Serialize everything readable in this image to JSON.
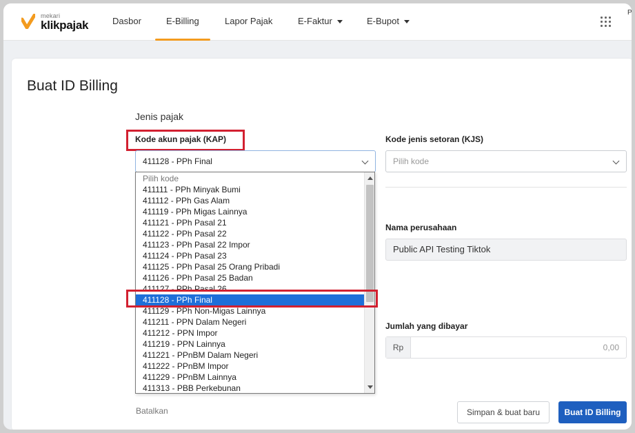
{
  "nav": {
    "logo_small": "mekari",
    "logo_big": "klikpajak",
    "items": [
      {
        "label": "Dasbor"
      },
      {
        "label": "E-Billing"
      },
      {
        "label": "Lapor Pajak"
      },
      {
        "label": "E-Faktur"
      },
      {
        "label": "E-Bupot"
      }
    ],
    "corner_letter": "P",
    "accent_color": "#f39b1f"
  },
  "page": {
    "title": "Buat ID Billing",
    "section": "Jenis pajak"
  },
  "form": {
    "kap_label": "Kode akun pajak (KAP)",
    "kap_value": "411128 - PPh Final",
    "kjs_label": "Kode jenis setoran (KJS)",
    "kjs_placeholder": "Pilih kode",
    "company_label": "Nama perusahaan",
    "company_value": "Public API Testing Tiktok",
    "amount_label": "Jumlah yang dibayar",
    "amount_prefix": "Rp",
    "amount_value": "0,00"
  },
  "dropdown": {
    "options": [
      "Pilih kode",
      "411111 - PPh Minyak Bumi",
      "411112 - PPh Gas Alam",
      "411119 - PPh Migas Lainnya",
      "411121 - PPh Pasal 21",
      "411122 - PPh Pasal 22",
      "411123 - PPh Pasal 22 Impor",
      "411124 - PPh Pasal 23",
      "411125 - PPh Pasal 25 Orang Pribadi",
      "411126 - PPh Pasal 25 Badan",
      "411127 - PPh Pasal 26",
      "411128 - PPh Final",
      "411129 - PPh Non-Migas Lainnya",
      "411211 - PPN Dalam Negeri",
      "411212 - PPN Impor",
      "411219 - PPN Lainnya",
      "411221 - PPnBM Dalam Negeri",
      "411222 - PPnBM Impor",
      "411229 - PPnBM Lainnya",
      "411313 - PBB Perkebunan"
    ],
    "selected_index": 11,
    "highlight_color": "#d22030",
    "selected_color": "#1e6fd9"
  },
  "actions": {
    "cancel": "Batalkan",
    "save_new": "Simpan & buat baru",
    "create": "Buat ID Billing"
  }
}
